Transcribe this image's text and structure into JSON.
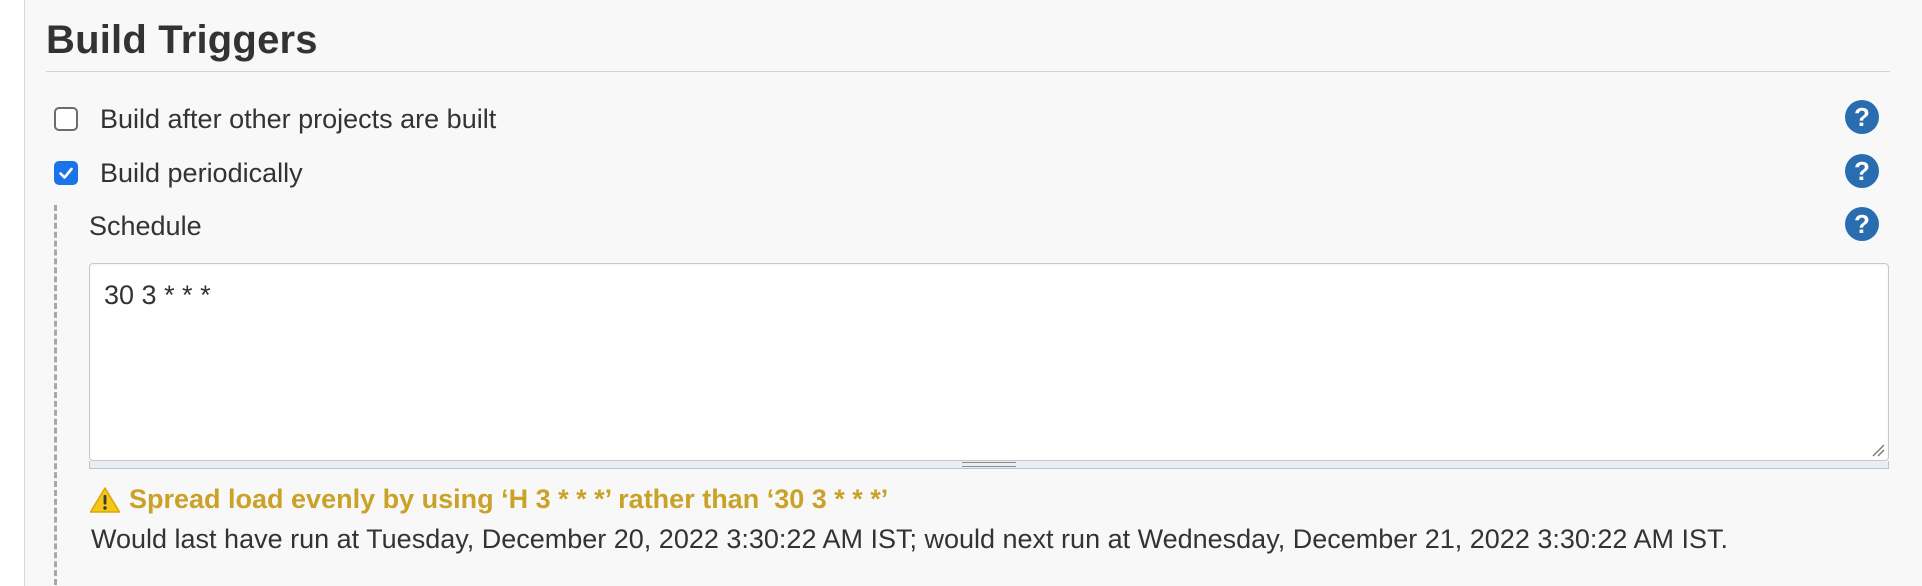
{
  "section": {
    "title": "Build Triggers"
  },
  "triggers": [
    {
      "label": "Build after other projects are built",
      "checked": false
    },
    {
      "label": "Build periodically",
      "checked": true
    }
  ],
  "schedule": {
    "label": "Schedule",
    "value": "30 3 * * *"
  },
  "validation": {
    "warning": "Spread load evenly by using ‘H 3 * * *’ rather than ‘30 3 * * *’",
    "info": "Would last have run at Tuesday, December 20, 2022 3:30:22 AM IST; would next run at Wednesday, December 21, 2022 3:30:22 AM IST."
  },
  "help": {
    "glyph": "?"
  },
  "colors": {
    "accent": "#1a73e8",
    "help": "#2a6cb0",
    "warning": "#c9a227"
  },
  "icons": {
    "help": "question-circle-icon",
    "warning": "warning-triangle-icon",
    "check": "checkmark-icon"
  }
}
